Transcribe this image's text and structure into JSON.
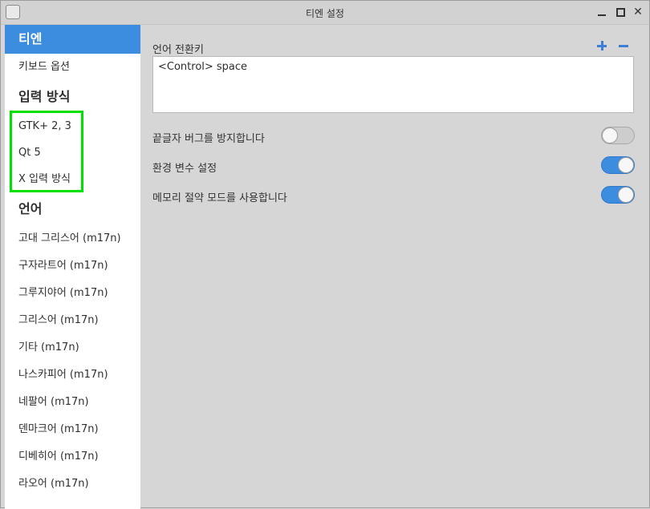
{
  "window": {
    "title": "티엔 설정",
    "close_glyph": "✕"
  },
  "sidebar": {
    "rows": [
      {
        "kind": "selected",
        "label": "티엔"
      },
      {
        "kind": "item",
        "label": "키보드 옵션"
      },
      {
        "kind": "header",
        "label": "입력 방식"
      },
      {
        "kind": "item",
        "label": "GTK+ 2, 3"
      },
      {
        "kind": "item",
        "label": "Qt 5"
      },
      {
        "kind": "item",
        "label": "X 입력 방식"
      },
      {
        "kind": "header",
        "label": "언어"
      },
      {
        "kind": "item",
        "label": "고대 그리스어 (m17n)"
      },
      {
        "kind": "item",
        "label": "구자라트어 (m17n)"
      },
      {
        "kind": "item",
        "label": "그루지야어 (m17n)"
      },
      {
        "kind": "item",
        "label": "그리스어 (m17n)"
      },
      {
        "kind": "item",
        "label": "기타 (m17n)"
      },
      {
        "kind": "item",
        "label": "나스카피어 (m17n)"
      },
      {
        "kind": "item",
        "label": "네팔어 (m17n)"
      },
      {
        "kind": "item",
        "label": "덴마크어 (m17n)"
      },
      {
        "kind": "item",
        "label": "디베히어 (m17n)"
      },
      {
        "kind": "item",
        "label": "라오어 (m17n)"
      }
    ]
  },
  "main": {
    "hotkey_label": "언어 전환키",
    "hotkey_value": "<Control> space",
    "options": [
      {
        "label": "끝글자 버그를 방지합니다",
        "enabled": false
      },
      {
        "label": "환경 변수 설정",
        "enabled": true
      },
      {
        "label": "메모리 절약 모드를 사용합니다",
        "enabled": true
      }
    ]
  },
  "colors": {
    "accent": "#3c8ce0",
    "highlight_box": "#00e000"
  }
}
